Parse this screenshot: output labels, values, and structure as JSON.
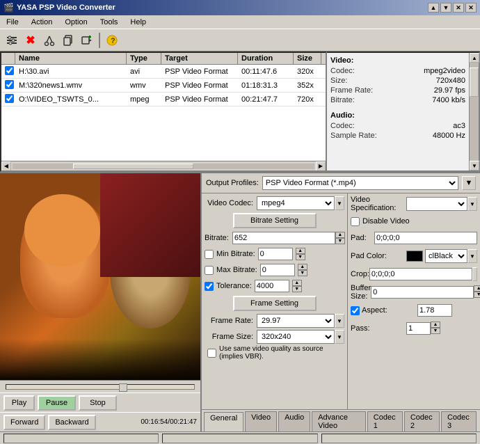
{
  "app": {
    "title": "YASA PSP Video Converter",
    "titlebar_controls": [
      "▲",
      "▼",
      "✕",
      "✕"
    ]
  },
  "menu": {
    "items": [
      "File",
      "Action",
      "Option",
      "Tools",
      "Help"
    ]
  },
  "toolbar": {
    "buttons": [
      {
        "name": "settings-icon",
        "icon": "⚙",
        "label": "Settings"
      },
      {
        "name": "delete-icon",
        "icon": "✖",
        "label": "Delete",
        "color": "red"
      },
      {
        "name": "cut-icon",
        "icon": "✂",
        "label": "Cut"
      },
      {
        "name": "copy-icon",
        "icon": "⎘",
        "label": "Copy"
      },
      {
        "name": "add-icon",
        "icon": "🎬",
        "label": "Add"
      },
      {
        "name": "info-icon",
        "icon": "ℹ",
        "label": "Info"
      }
    ]
  },
  "file_list": {
    "columns": [
      "Name",
      "Type",
      "Target",
      "Duration",
      "Size"
    ],
    "rows": [
      {
        "checked": true,
        "name": "H:\\30.avi",
        "type": "avi",
        "target": "PSP Video Format",
        "duration": "00:11:47.6",
        "size": "320x"
      },
      {
        "checked": true,
        "name": "M:\\320news1.wmv",
        "type": "wmv",
        "target": "PSP Video Format",
        "duration": "01:18:31.3",
        "size": "352x"
      },
      {
        "checked": true,
        "name": "O:\\VIDEO_TSWTS_0...",
        "type": "mpeg",
        "target": "PSP Video Format",
        "duration": "00:21:47.7",
        "size": "720x"
      }
    ]
  },
  "video_info": {
    "video_title": "Video:",
    "codec_label": "Codec:",
    "codec_value": "mpeg2video",
    "size_label": "Size:",
    "size_value": "720x480",
    "framerate_label": "Frame Rate:",
    "framerate_value": "29.97 fps",
    "bitrate_label": "Bitrate:",
    "bitrate_value": "7400 kb/s",
    "audio_title": "Audio:",
    "audio_codec_label": "Codec:",
    "audio_codec_value": "ac3",
    "samplerate_label": "Sample Rate:",
    "samplerate_value": "48000 Hz"
  },
  "settings": {
    "output_profiles_label": "Output Profiles:",
    "output_profiles_value": "PSP Video Format (*.mp4)",
    "video_codec_label": "Video Codec:",
    "video_codec_value": "mpeg4",
    "video_spec_label": "Video Specification:",
    "video_spec_value": "",
    "bitrate_section": "Bitrate Setting",
    "bitrate_label": "Bitrate:",
    "bitrate_value": "652",
    "min_bitrate_label": "Min Bitrate:",
    "min_bitrate_value": "0",
    "max_bitrate_label": "Max Bitrate:",
    "max_bitrate_value": "0",
    "tolerance_label": "Tolerance:",
    "tolerance_value": "4000",
    "frame_section": "Frame Setting",
    "frame_rate_label": "Frame Rate:",
    "frame_rate_value": "29.97",
    "frame_size_label": "Frame Size:",
    "frame_size_value": "320x240",
    "use_quality_label": "Use same video quality as source (implies VBR).",
    "disable_video_label": "Disable Video",
    "pad_label": "Pad:",
    "pad_value": "0;0;0;0",
    "pad_color_label": "Pad Color:",
    "pad_color_value": "clBlack",
    "crop_label": "Crop:",
    "crop_value": "0;0;0;0",
    "buffer_size_label": "Buffer Size:",
    "buffer_size_value": "0",
    "aspect_label": "Aspect:",
    "aspect_value": "1.78",
    "pass_label": "Pass:",
    "pass_value": "1"
  },
  "player": {
    "play_label": "Play",
    "pause_label": "Pause",
    "stop_label": "Stop",
    "forward_label": "Forward",
    "backward_label": "Backward",
    "time_display": "00:16:54/00:21:47"
  },
  "tabs": {
    "items": [
      "General",
      "Video",
      "Audio",
      "Advance Video",
      "Codec 1",
      "Codec 2",
      "Codec 3"
    ],
    "active": "General"
  },
  "statusbar": {
    "left": "",
    "right": ""
  }
}
